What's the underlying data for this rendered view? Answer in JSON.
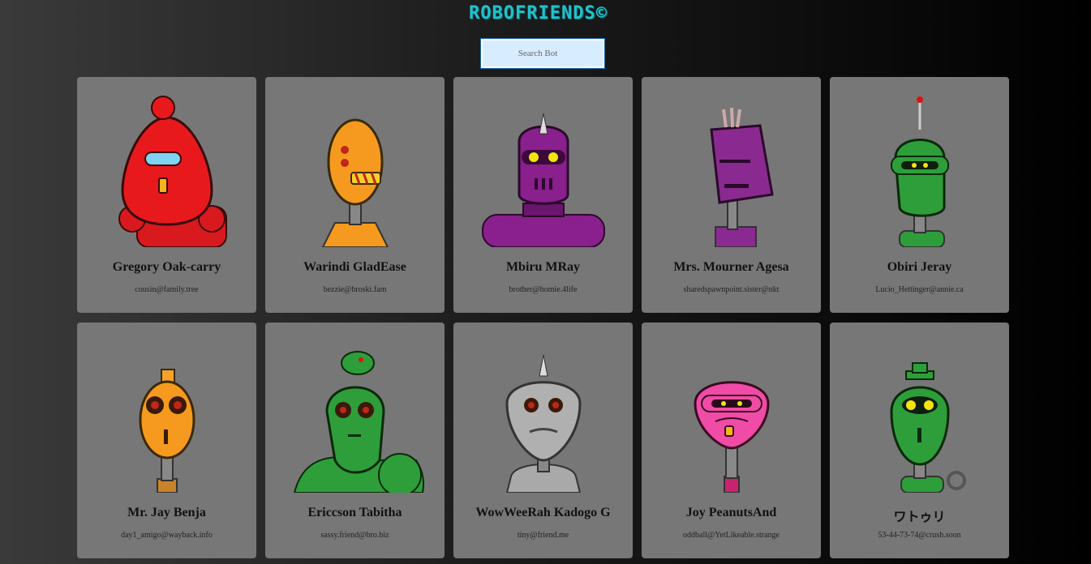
{
  "app": {
    "title": "ROBOFRIENDS©"
  },
  "search": {
    "placeholder": "Search Bot"
  },
  "robots": [
    {
      "name": "Gregory Oak-carry",
      "email": "cousin@family.tree",
      "color": "#e0191c",
      "icon": "robot-avatar-red"
    },
    {
      "name": "Warindi GladEase",
      "email": "bezzie@broski.fam",
      "color": "#f59a1e",
      "icon": "robot-avatar-orange"
    },
    {
      "name": "Mbiru MRay",
      "email": "brother@homie.4life",
      "color": "#8a1f8e",
      "icon": "robot-avatar-purple"
    },
    {
      "name": "Mrs. Mourner Agesa",
      "email": "sharedspawnpoint.sister@nkt",
      "color": "#8a2a90",
      "icon": "robot-avatar-purple-bucket"
    },
    {
      "name": "Obiri Jeray",
      "email": "Lucio_Hettinger@annie.ca",
      "color": "#2e9e3a",
      "icon": "robot-avatar-green-antenna"
    },
    {
      "name": "Mr. Jay Benja",
      "email": "day1_amigo@wayback.info",
      "color": "#f59a1e",
      "icon": "robot-avatar-orange-round"
    },
    {
      "name": "Ericcson Tabitha",
      "email": "sassy.friend@bro.biz",
      "color": "#2e9e3a",
      "icon": "robot-avatar-green-dome"
    },
    {
      "name": "WowWeeRah Kadogo G",
      "email": "tiny@friend.me",
      "color": "#a9a9a9",
      "icon": "robot-avatar-silver"
    },
    {
      "name": "Joy PeanutsAnd",
      "email": "oddball@YetLikeable.strange",
      "color": "#f04ba6",
      "icon": "robot-avatar-pink"
    },
    {
      "name": "ワトゥリ",
      "email": "53-44-73-74@crush.soon",
      "color": "#2e9e3a",
      "icon": "robot-avatar-green-hat"
    }
  ]
}
